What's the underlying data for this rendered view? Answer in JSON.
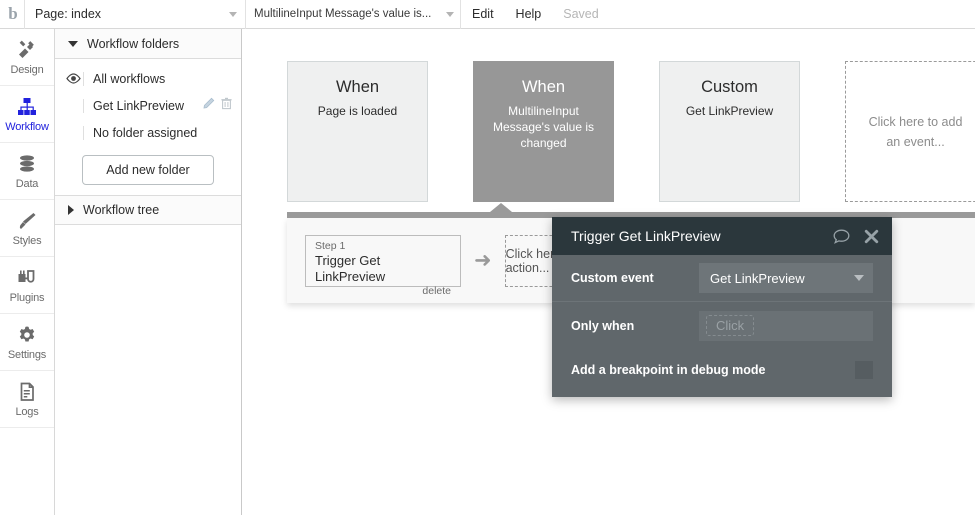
{
  "topbar": {
    "logo": "b",
    "page_label": "Page: index",
    "event_label": "MultilineInput Message's value is...",
    "menu": [
      {
        "label": "Edit",
        "muted": false
      },
      {
        "label": "Help",
        "muted": false
      },
      {
        "label": "Saved",
        "muted": true
      }
    ]
  },
  "rail": {
    "items": [
      {
        "label": "Design",
        "icon": "design-icon",
        "active": false
      },
      {
        "label": "Workflow",
        "icon": "workflow-icon",
        "active": true
      },
      {
        "label": "Data",
        "icon": "data-icon",
        "active": false
      },
      {
        "label": "Styles",
        "icon": "styles-icon",
        "active": false
      },
      {
        "label": "Plugins",
        "icon": "plugins-icon",
        "active": false
      },
      {
        "label": "Settings",
        "icon": "settings-icon",
        "active": false
      },
      {
        "label": "Logs",
        "icon": "logs-icon",
        "active": false
      }
    ]
  },
  "panel": {
    "folders_title": "Workflow folders",
    "rows": [
      {
        "label": "All workflows",
        "eye": true,
        "actions": false
      },
      {
        "label": "Get LinkPreview",
        "eye": false,
        "actions": true
      },
      {
        "label": "No folder assigned",
        "eye": false,
        "actions": false
      }
    ],
    "add_folder_label": "Add new folder",
    "tree_title": "Workflow tree"
  },
  "canvas": {
    "events": [
      {
        "title": "When",
        "subtitle": "Page is loaded",
        "state": "plain"
      },
      {
        "title": "When",
        "subtitle": "MultilineInput Message's value is changed",
        "state": "selected"
      },
      {
        "title": "Custom",
        "subtitle": "Get LinkPreview",
        "state": "plain"
      },
      {
        "placeholder": "Click here to add an event...",
        "state": "dashed"
      }
    ],
    "steps": [
      {
        "number": "Step 1",
        "name": "Trigger Get LinkPreview",
        "delete_label": "delete"
      }
    ],
    "step_add_label": "Click here to add an action..."
  },
  "modal": {
    "title": "Trigger Get LinkPreview",
    "comment_icon": "comment-icon",
    "close_icon": "close-icon",
    "custom_event_label": "Custom event",
    "custom_event_value": "Get LinkPreview",
    "only_when_label": "Only when",
    "only_when_placeholder": "Click",
    "breakpoint_label": "Add a breakpoint in debug mode"
  },
  "colors": {
    "accent": "#2222dd",
    "modal_header": "#2b373c",
    "modal_body": "#60676b",
    "selected_card": "#979797"
  }
}
